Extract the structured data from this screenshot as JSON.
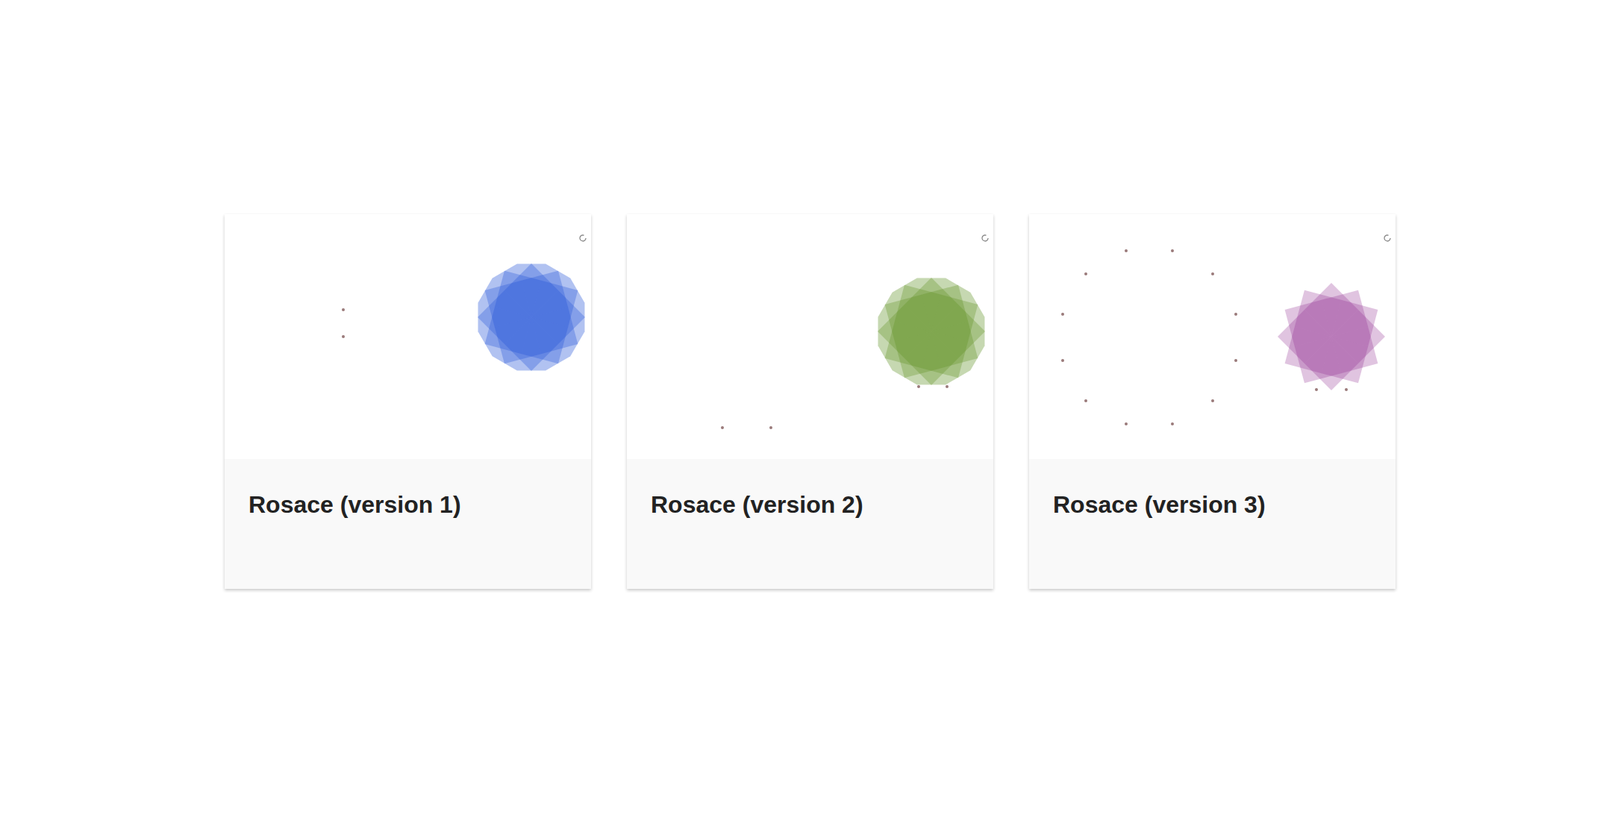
{
  "cards": [
    {
      "title": "Rosace (version 1)",
      "kind": "tiled",
      "color": "#1f4fd6"
    },
    {
      "title": "Rosace (version 2)",
      "kind": "tiled",
      "color": "#5d8f1f"
    },
    {
      "title": "Rosace (version 3)",
      "kind": "overlay",
      "color": "#8e2a8f"
    }
  ]
}
